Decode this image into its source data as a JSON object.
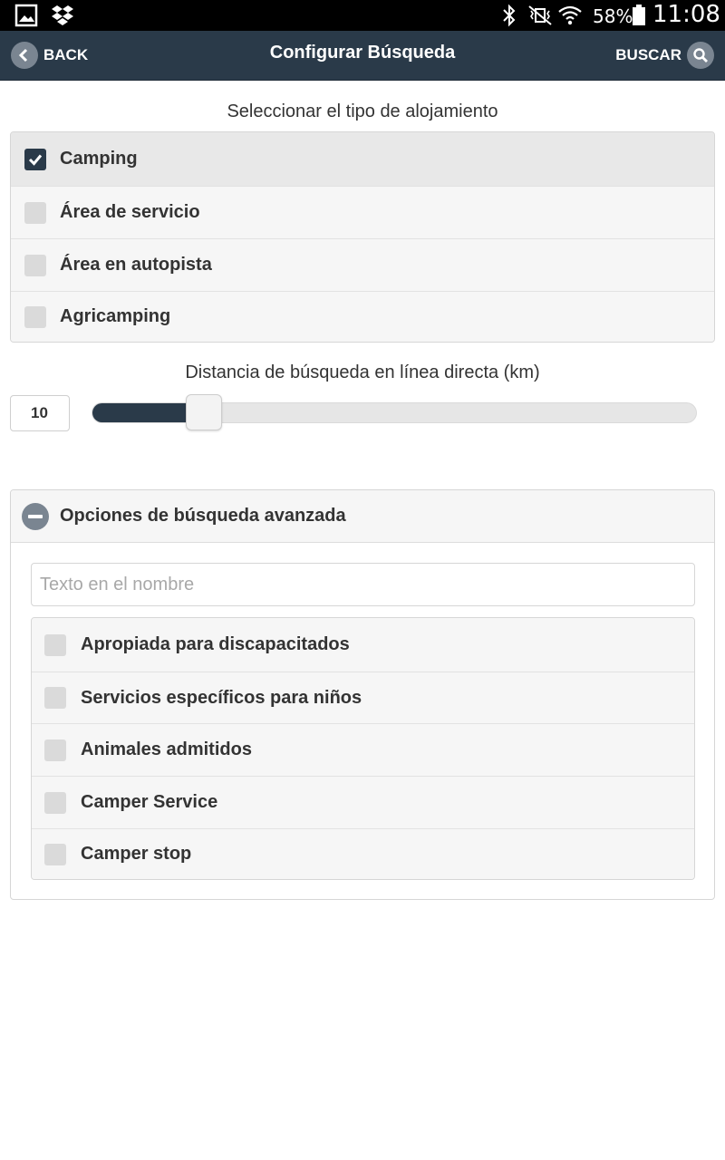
{
  "status_bar": {
    "battery_percent": "58%",
    "time": "11:08",
    "icons": [
      "gallery-icon",
      "dropbox-icon",
      "bluetooth-icon",
      "vibrate-mute-icon",
      "wifi-icon",
      "battery-icon"
    ]
  },
  "header": {
    "back_label": "BACK",
    "title": "Configurar Búsqueda",
    "search_label": "BUSCAR",
    "color": "#2a3a49"
  },
  "accommodation": {
    "label": "Seleccionar el tipo de alojamiento",
    "options": [
      {
        "label": "Camping",
        "checked": true
      },
      {
        "label": "Área de servicio",
        "checked": false
      },
      {
        "label": "Área en autopista",
        "checked": false
      },
      {
        "label": "Agricamping",
        "checked": false
      }
    ]
  },
  "distance": {
    "label": "Distancia de búsqueda en línea directa (km)",
    "value": "10",
    "slider_fraction": 0.185
  },
  "advanced": {
    "title": "Opciones de búsqueda avanzada",
    "name_placeholder": "Texto en el nombre",
    "options": [
      {
        "label": "Apropiada para discapacitados",
        "checked": false
      },
      {
        "label": "Servicios específicos para niños",
        "checked": false
      },
      {
        "label": "Animales admitidos",
        "checked": false
      },
      {
        "label": "Camper Service",
        "checked": false
      },
      {
        "label": "Camper stop",
        "checked": false
      }
    ]
  }
}
